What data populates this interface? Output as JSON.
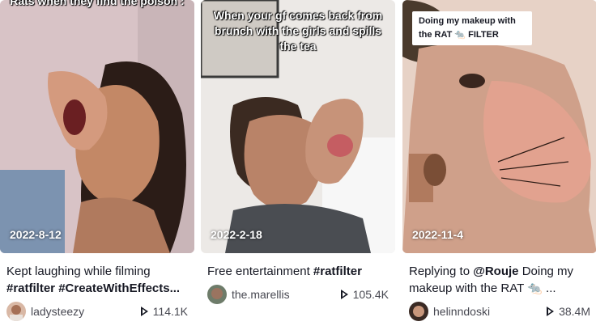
{
  "videos": [
    {
      "overlay": "Rats when they find the poison :",
      "date": "2022-8-12",
      "desc_text": "Kept laughing while filming",
      "desc_tags": "#ratfilter #CreateWithEffects...",
      "username": "ladysteezy",
      "views": "114.1K"
    },
    {
      "overlay": "When your gf comes back from brunch with the girls and spills the tea",
      "date": "2022-2-18",
      "desc_text": "Free entertainment",
      "desc_tags": "#ratfilter",
      "username": "the.marellis",
      "views": "105.4K"
    },
    {
      "overlay": "Doing my makeup with the RAT 🐀 FILTER",
      "date": "2022-11-4",
      "desc_prefix": "Replying to",
      "desc_mention": "@Rouje",
      "desc_text": "Doing my makeup with the RAT 🐀 ...",
      "username": "helinndoski",
      "views": "38.4M"
    }
  ],
  "icons": {
    "views": "play-outline-icon"
  }
}
